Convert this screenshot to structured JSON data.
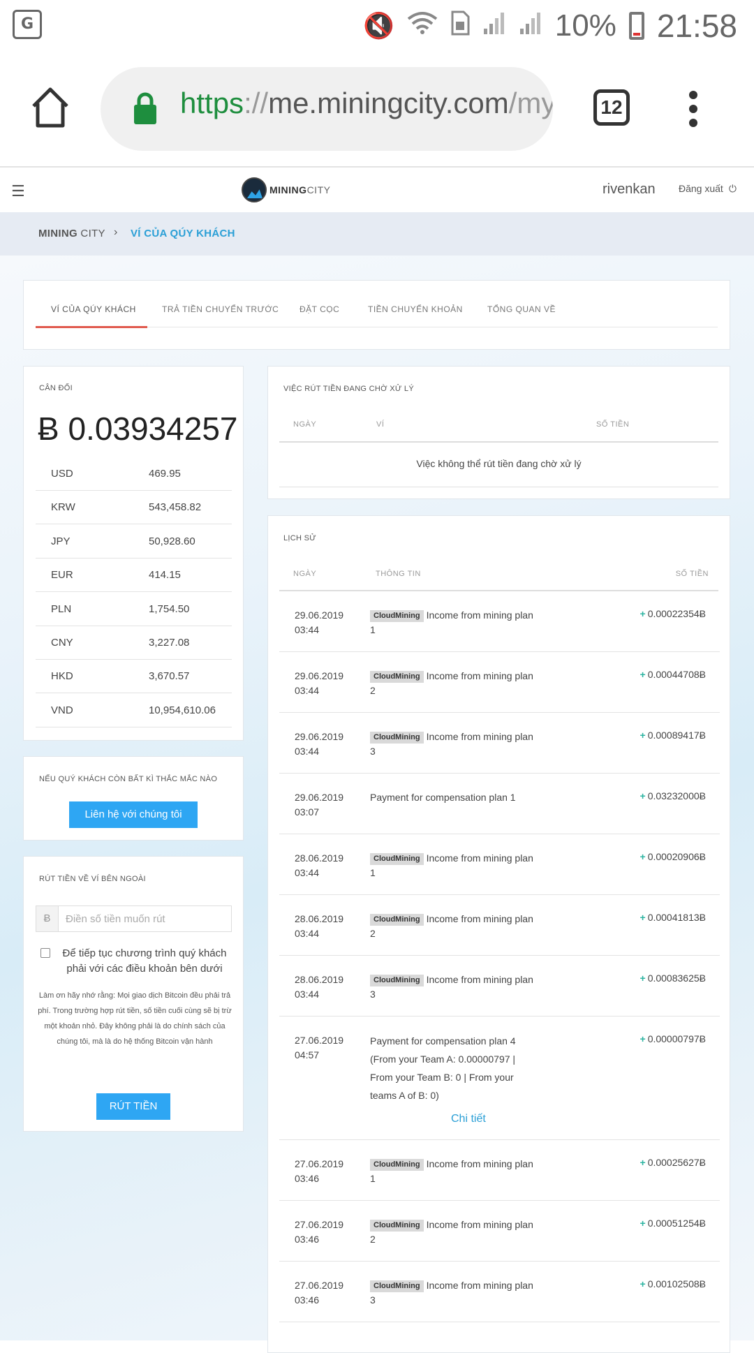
{
  "status_bar": {
    "left_icon": "translate-icon",
    "icons": [
      "mute-icon",
      "wifi-icon",
      "sim-icon",
      "signal-icon",
      "signal-icon"
    ],
    "battery": "10%",
    "time": "21:58"
  },
  "browser": {
    "url_scheme": "https",
    "url_sep": "://",
    "url_host": "me.miningcity.com",
    "url_path": "/my",
    "tab_count": "12"
  },
  "header": {
    "logo_main": "MINING",
    "logo_sub": "CITY",
    "username": "rivenkan",
    "logout": "Đăng xuất"
  },
  "breadcrumb": {
    "root_bold": "MINING",
    "root_rest": " CITY",
    "separator": "›",
    "current": "VÍ CỦA QÚY KHÁCH"
  },
  "tabs": [
    {
      "label": "VÍ CỦA QÚY KHÁCH",
      "active": true
    },
    {
      "label": "TRẢ TIỀN CHUYỂN TRƯỚC",
      "active": false
    },
    {
      "label": "ĐẶT CỌC",
      "active": false
    },
    {
      "label": "TIỀN CHUYỂN KHOẢN",
      "active": false
    },
    {
      "label": "TỔNG QUAN VỀ",
      "active": false
    }
  ],
  "balance": {
    "title": "CÂN ĐỐI",
    "amount": "Ƀ 0.03934257",
    "currencies": [
      {
        "code": "USD",
        "value": "469.95"
      },
      {
        "code": "KRW",
        "value": "543,458.82"
      },
      {
        "code": "JPY",
        "value": "50,928.60"
      },
      {
        "code": "EUR",
        "value": "414.15"
      },
      {
        "code": "PLN",
        "value": "1,754.50"
      },
      {
        "code": "CNY",
        "value": "3,227.08"
      },
      {
        "code": "HKD",
        "value": "3,670.57"
      },
      {
        "code": "VND",
        "value": "10,954,610.06"
      }
    ]
  },
  "contact": {
    "title": "NẾU QUÝ KHÁCH CÒN BẤT KÌ THẮC MẮC NÀO",
    "button": "Liên hệ với chúng tôi"
  },
  "withdraw": {
    "title": "RÚT TIỀN VỀ VÍ BÊN NGOÀI",
    "addon": "Ƀ",
    "placeholder": "Điền số tiền muốn rút",
    "checkbox_label": "Để tiếp tục chương trình quý khách phải với các điều khoản bên dưới",
    "note": "Làm ơn hãy nhớ rằng: Mọi giao dịch Bitcoin đều phải trả phí. Trong trường hợp rút tiền, số tiền cuối cùng sẽ bị trừ một khoản nhỏ. Đây không phải là do chính sách của chúng tôi, mà là do hệ thống Bitcoin vận hành",
    "button": "RÚT TIỀN"
  },
  "pending": {
    "title": "VIỆC RÚT TIỀN ĐANG CHỜ XỬ LÝ",
    "col_date": "NGÀY",
    "col_wallet": "VÍ",
    "col_amount": "SỐ TIỀN",
    "empty": "Việc không thể rút tiền đang chờ xử lý"
  },
  "history": {
    "title": "LỊCH SỬ",
    "col_date": "NGÀY",
    "col_info": "THÔNG TIN",
    "col_amount": "SỐ TIỀN",
    "plus": "+",
    "detail_link": "Chi tiết",
    "rows": [
      {
        "date": "29.06.2019",
        "time": "03:44",
        "badge": "CloudMining",
        "info": "Income from mining plan 1",
        "amount": "0.00022354Ƀ"
      },
      {
        "date": "29.06.2019",
        "time": "03:44",
        "badge": "CloudMining",
        "info": "Income from mining plan 2",
        "amount": "0.00044708Ƀ"
      },
      {
        "date": "29.06.2019",
        "time": "03:44",
        "badge": "CloudMining",
        "info": "Income from mining plan 3",
        "amount": "0.00089417Ƀ"
      },
      {
        "date": "29.06.2019",
        "time": "03:07",
        "badge": "",
        "info": "Payment for compensation plan 1",
        "amount": "0.03232000Ƀ"
      },
      {
        "date": "28.06.2019",
        "time": "03:44",
        "badge": "CloudMining",
        "info": "Income from mining plan 1",
        "amount": "0.00020906Ƀ"
      },
      {
        "date": "28.06.2019",
        "time": "03:44",
        "badge": "CloudMining",
        "info": "Income from mining plan 2",
        "amount": "0.00041813Ƀ"
      },
      {
        "date": "28.06.2019",
        "time": "03:44",
        "badge": "CloudMining",
        "info": "Income from mining plan 3",
        "amount": "0.00083625Ƀ"
      },
      {
        "date": "27.06.2019",
        "time": "04:57",
        "badge": "",
        "info": "Payment for compensation plan 4 (From your Team A: 0.00000797 | From your Team B: 0 | From your teams A of B: 0)",
        "amount": "0.00000797Ƀ"
      },
      {
        "date": "27.06.2019",
        "time": "03:46",
        "badge": "CloudMining",
        "info": "Income from mining plan 1",
        "amount": "0.00025627Ƀ"
      },
      {
        "date": "27.06.2019",
        "time": "03:46",
        "badge": "CloudMining",
        "info": "Income from mining plan 2",
        "amount": "0.00051254Ƀ"
      },
      {
        "date": "27.06.2019",
        "time": "03:46",
        "badge": "CloudMining",
        "info": "Income from mining plan 3",
        "amount": "0.00102508Ƀ"
      }
    ]
  },
  "colors": {
    "accent_blue": "#2ea6f3",
    "link_blue": "#2a9fd6",
    "tab_underline": "#e05a4e",
    "plus_green": "#2bb3a0",
    "url_green": "#1e8e3e"
  }
}
